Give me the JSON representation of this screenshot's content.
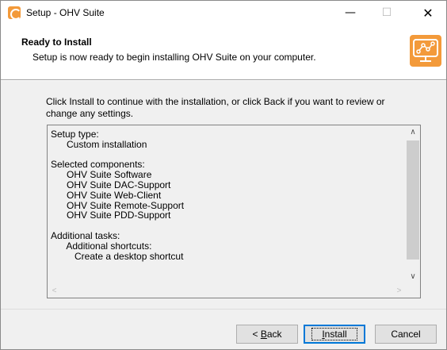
{
  "window": {
    "title": "Setup - OHV Suite",
    "min_glyph": "—",
    "max_glyph": "☐",
    "close_glyph": "✕"
  },
  "header": {
    "title": "Ready to Install",
    "subtitle": "Setup is now ready to begin installing OHV Suite on your computer.",
    "logo_icon": "monitor-chart-icon"
  },
  "body": {
    "intro": "Click Install to continue with the installation, or click Back if you want to review or change any settings.",
    "memo_lines": [
      "Setup type:",
      "      Custom installation",
      "",
      "Selected components:",
      "      OHV Suite Software",
      "      OHV Suite DAC-Support",
      "      OHV Suite Web-Client",
      "      OHV Suite Remote-Support",
      "      OHV Suite PDD-Support",
      "",
      "Additional tasks:",
      "      Additional shortcuts:",
      "         Create a desktop shortcut"
    ]
  },
  "footer": {
    "back_prefix": "< ",
    "back_u": "B",
    "back_rest": "ack",
    "install_u": "I",
    "install_rest": "nstall",
    "cancel_label": "Cancel"
  },
  "colors": {
    "accent": "#f39a3a",
    "focus_border": "#0078d7"
  }
}
